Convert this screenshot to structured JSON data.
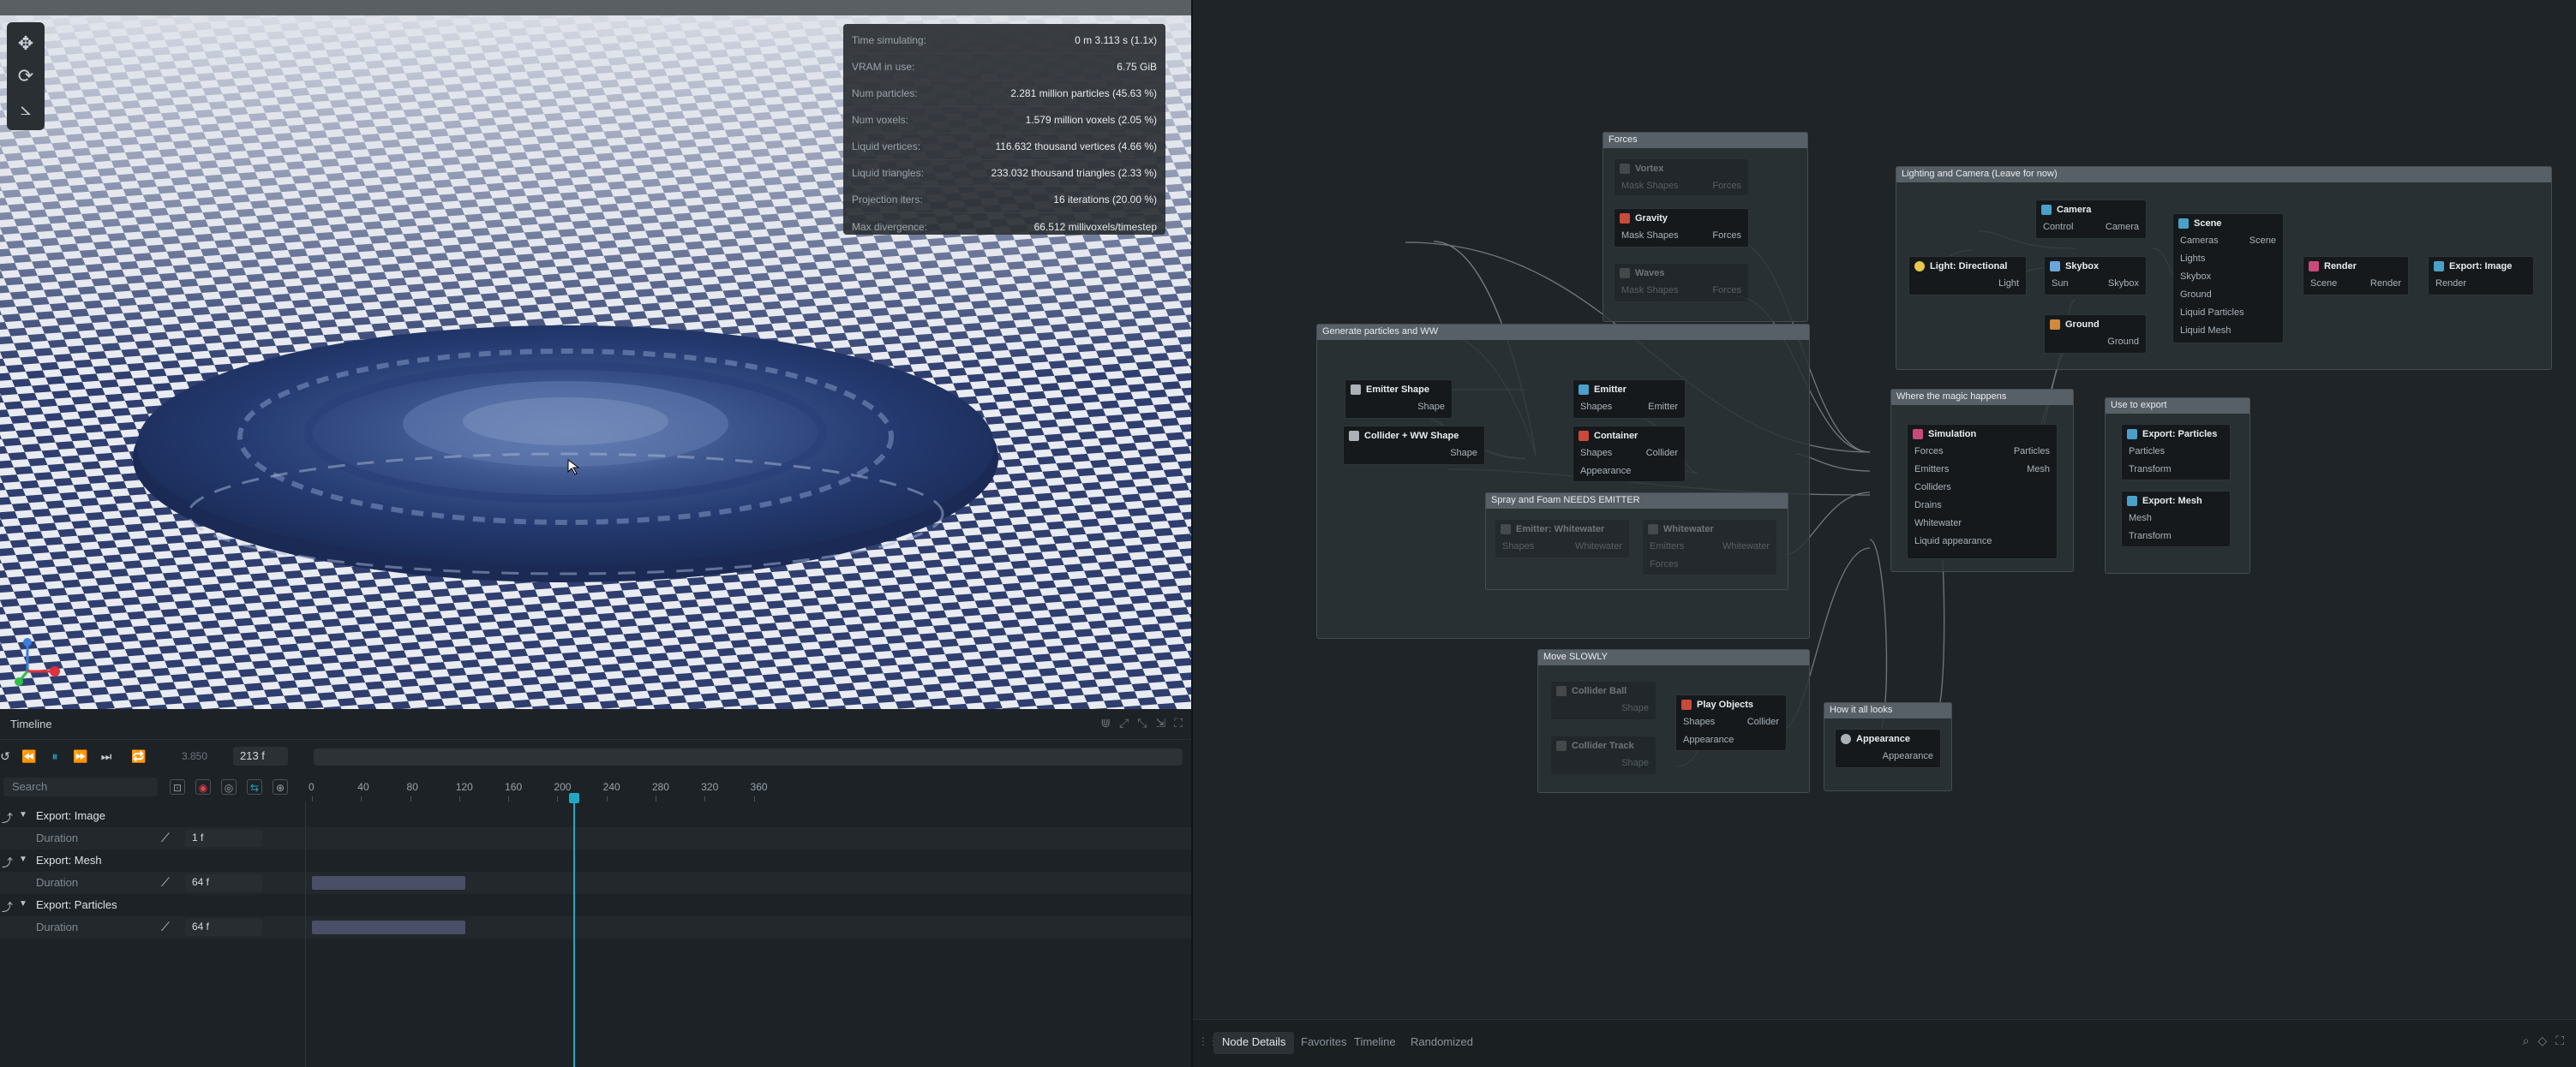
{
  "viewport": {
    "toolbar": {
      "move": "move-tool",
      "rotate": "rotate-tool",
      "axes": "axes-tool"
    },
    "stats": [
      {
        "k": "Time simulating:",
        "v": "0 m 3.113 s (1.1x)"
      },
      {
        "k": "VRAM in use:",
        "v": "6.75 GiB"
      },
      {
        "k": "Num particles:",
        "v": "2.281 million particles (45.63 %)"
      },
      {
        "k": "Num voxels:",
        "v": "1.579 million voxels (2.05 %)"
      },
      {
        "k": "Liquid vertices:",
        "v": "116.632 thousand vertices (4.66 %)"
      },
      {
        "k": "Liquid triangles:",
        "v": "233.032 thousand triangles (2.33 %)"
      },
      {
        "k": "Projection iters:",
        "v": "16 iterations (20.00 %)"
      },
      {
        "k": "Max divergence:",
        "v": "66.512 millivoxels/timestep"
      }
    ]
  },
  "timeline": {
    "title": "Timeline",
    "fps": "3.850",
    "frame": "213 f",
    "search_placeholder": "Search",
    "ticks": [
      "0",
      "40",
      "80",
      "120",
      "160",
      "200",
      "240",
      "280",
      "320",
      "360"
    ],
    "playhead_frame": 213,
    "max_frame": 372,
    "tracks": [
      {
        "name": "Export: Image",
        "param": "Duration",
        "value": "1 f",
        "bar_end": 0
      },
      {
        "name": "Export: Mesh",
        "param": "Duration",
        "value": "64 f",
        "bar_end": 64
      },
      {
        "name": "Export: Particles",
        "param": "Duration",
        "value": "64 f",
        "bar_end": 64
      }
    ]
  },
  "graph": {
    "groups": {
      "forces": "Forces",
      "lighting": "Lighting and Camera (Leave for now)",
      "generate": "Generate particles and WW",
      "spray": "Spray and Foam NEEDS EMITTER",
      "magic": "Where the magic happens",
      "export": "Use to export",
      "move": "Move SLOWLY",
      "looks": "How it all looks"
    },
    "nodes": {
      "vortex": {
        "title": "Vortex",
        "in": "Mask Shapes",
        "out": "Forces"
      },
      "gravity": {
        "title": "Gravity",
        "in": "Mask Shapes",
        "out": "Forces"
      },
      "waves": {
        "title": "Waves",
        "in": "Mask Shapes",
        "out": "Forces"
      },
      "camera": {
        "title": "Camera",
        "in": "Control",
        "out": "Camera"
      },
      "scene": {
        "title": "Scene",
        "in": [
          "Cameras",
          "Lights",
          "Skybox",
          "Ground",
          "Liquid Particles",
          "Liquid Mesh"
        ],
        "out": "Scene"
      },
      "light": {
        "title": "Light: Directional",
        "out": "Light"
      },
      "skybox": {
        "title": "Skybox",
        "in": "Sun",
        "out": "Skybox"
      },
      "ground": {
        "title": "Ground",
        "out": "Ground"
      },
      "render": {
        "title": "Render",
        "in": "Scene",
        "out": "Render"
      },
      "exportimage": {
        "title": "Export: Image",
        "in": "Render"
      },
      "emittershape": {
        "title": "Emitter Shape",
        "out": "Shape"
      },
      "colliderww": {
        "title": "Collider + WW Shape",
        "out": "Shape"
      },
      "emitter": {
        "title": "Emitter",
        "in": "Shapes",
        "out": "Emitter"
      },
      "container": {
        "title": "Container",
        "in": [
          "Shapes",
          "Appearance"
        ],
        "out": "Collider"
      },
      "emitterww": {
        "title": "Emitter: Whitewater",
        "in": "Shapes",
        "out": "Whitewater"
      },
      "whitewater": {
        "title": "Whitewater",
        "in": [
          "Emitters",
          "Forces"
        ],
        "out": "Whitewater"
      },
      "simulation": {
        "title": "Simulation",
        "in": [
          "Forces",
          "Emitters",
          "Colliders",
          "Drains",
          "Whitewater",
          "Liquid appearance"
        ],
        "out": [
          "Particles",
          "Mesh"
        ]
      },
      "exportparticles": {
        "title": "Export: Particles",
        "in": [
          "Particles",
          "Transform"
        ]
      },
      "exportmesh": {
        "title": "Export: Mesh",
        "in": [
          "Mesh",
          "Transform"
        ]
      },
      "colliderball": {
        "title": "Collider Ball",
        "out": "Shape"
      },
      "collidertrack": {
        "title": "Collider Track",
        "out": "Shape"
      },
      "playobjects": {
        "title": "Play Objects",
        "in": [
          "Shapes",
          "Appearance"
        ],
        "out": "Collider"
      },
      "appearance": {
        "title": "Appearance",
        "out": "Appearance"
      }
    },
    "colors": {
      "accent": "#22a8c4",
      "group_header": "#586067",
      "node_bg": "#15191c"
    }
  },
  "bottom_tabs": [
    "Node Details",
    "Favorites",
    "Timeline",
    "Randomized"
  ]
}
